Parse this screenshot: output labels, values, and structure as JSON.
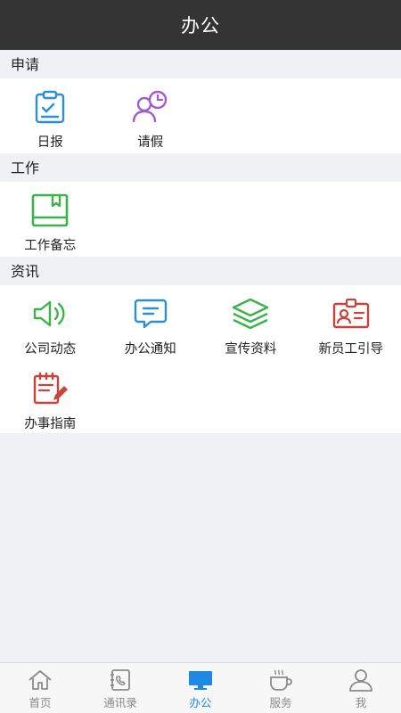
{
  "header": {
    "title": "办公"
  },
  "sections": [
    {
      "title": "申请",
      "items": [
        {
          "label": "日报",
          "icon": "clipboard-check-icon"
        },
        {
          "label": "请假",
          "icon": "user-clock-icon"
        }
      ]
    },
    {
      "title": "工作",
      "items": [
        {
          "label": "工作备忘",
          "icon": "memo-box-icon"
        }
      ]
    },
    {
      "title": "资讯",
      "items": [
        {
          "label": "公司动态",
          "icon": "speaker-icon"
        },
        {
          "label": "办公通知",
          "icon": "chat-bubble-icon"
        },
        {
          "label": "宣传资料",
          "icon": "layers-icon"
        },
        {
          "label": "新员工引导",
          "icon": "id-card-icon"
        },
        {
          "label": "办事指南",
          "icon": "notepad-pen-icon"
        }
      ]
    }
  ],
  "tabbar": {
    "items": [
      {
        "label": "首页",
        "icon": "home-icon"
      },
      {
        "label": "通讯录",
        "icon": "contacts-icon"
      },
      {
        "label": "办公",
        "icon": "monitor-icon"
      },
      {
        "label": "服务",
        "icon": "coffee-icon"
      },
      {
        "label": "我",
        "icon": "user-icon"
      }
    ],
    "active_index": 2
  },
  "colors": {
    "topbar": "#343434",
    "active_tab": "#1e88e5",
    "blue_icon": "#2b8fd8",
    "purple_icon": "#a35ad0",
    "green_icon": "#3bb34a",
    "red_icon": "#c9433a"
  }
}
